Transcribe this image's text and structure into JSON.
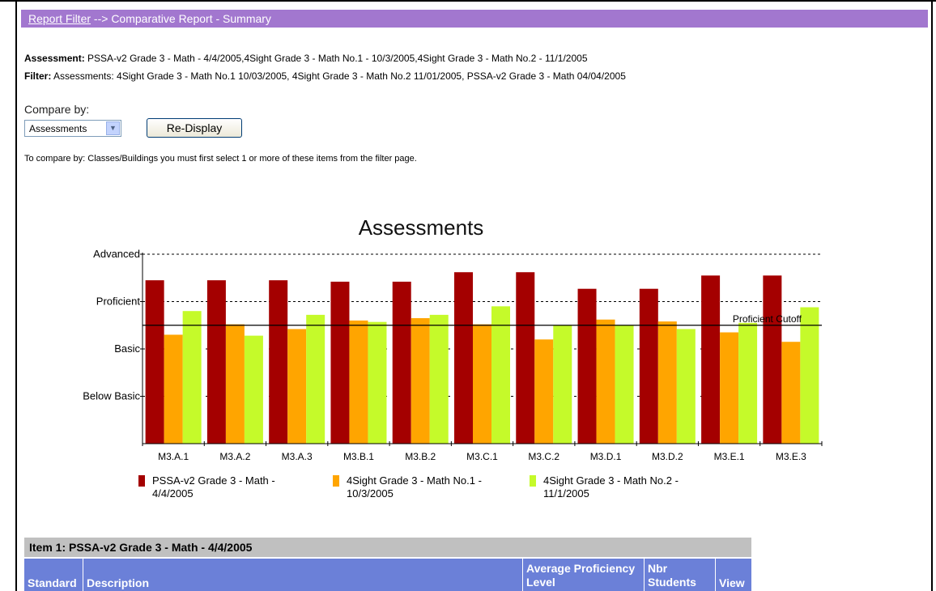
{
  "breadcrumb": {
    "link": "Report Filter",
    "separator": "-->",
    "current": "Comparative Report - Summary"
  },
  "assessment": {
    "label": "Assessment:",
    "value": "PSSA-v2 Grade 3 - Math - 4/4/2005,4Sight Grade 3 - Math No.1 - 10/3/2005,4Sight Grade 3 - Math No.2 - 11/1/2005"
  },
  "filter": {
    "label": "Filter:",
    "value": "Assessments: 4Sight Grade 3 - Math No.1 10/03/2005, 4Sight Grade 3 - Math No.2 11/01/2005, PSSA-v2 Grade 3 - Math 04/04/2005"
  },
  "compare": {
    "label": "Compare by:",
    "selected": "Assessments",
    "button": "Re-Display",
    "note": "To compare by: Classes/Buildings you must first select 1 or more of these items from the filter page."
  },
  "colors": {
    "header_bar": "#a277cf",
    "series1": "#a40000",
    "series2": "#ffa500",
    "series3": "#c5fa2a",
    "table_header": "#6b80d8"
  },
  "chart_data": {
    "type": "bar",
    "title": "Assessments",
    "categories": [
      "M3.A.1",
      "M3.A.2",
      "M3.A.3",
      "M3.B.1",
      "M3.B.2",
      "M3.C.1",
      "M3.C.2",
      "M3.D.1",
      "M3.D.2",
      "M3.E.1",
      "M3.E.3"
    ],
    "y_tick_labels": [
      "Below Basic",
      "Basic",
      "Proficient",
      "Advanced"
    ],
    "ylim": [
      0,
      4
    ],
    "grid": "dashed horizontal at Advanced and Proficient",
    "cutoff": {
      "label": "Proficient Cutoff",
      "value": 2.5
    },
    "series": [
      {
        "name": "PSSA-v2 Grade 3 - Math - 4/4/2005",
        "color": "#a40000",
        "values": [
          3.45,
          3.45,
          3.45,
          3.42,
          3.42,
          3.62,
          3.62,
          3.27,
          3.27,
          3.55,
          3.55
        ]
      },
      {
        "name": "4Sight Grade 3 - Math No.1 - 10/3/2005",
        "color": "#ffa500",
        "values": [
          2.3,
          2.52,
          2.42,
          2.6,
          2.65,
          2.52,
          2.2,
          2.62,
          2.58,
          2.35,
          2.15
        ]
      },
      {
        "name": "4Sight Grade 3 - Math No.2 - 11/1/2005",
        "color": "#c5fa2a",
        "values": [
          2.8,
          2.28,
          2.72,
          2.57,
          2.72,
          2.9,
          2.5,
          2.5,
          2.42,
          2.55,
          2.88
        ]
      }
    ]
  },
  "table": {
    "title": "Item 1: PSSA-v2 Grade 3 - Math - 4/4/2005",
    "headers": [
      "Standard",
      "Description",
      "Average Proficiency Level",
      "Nbr Students",
      "View"
    ]
  }
}
